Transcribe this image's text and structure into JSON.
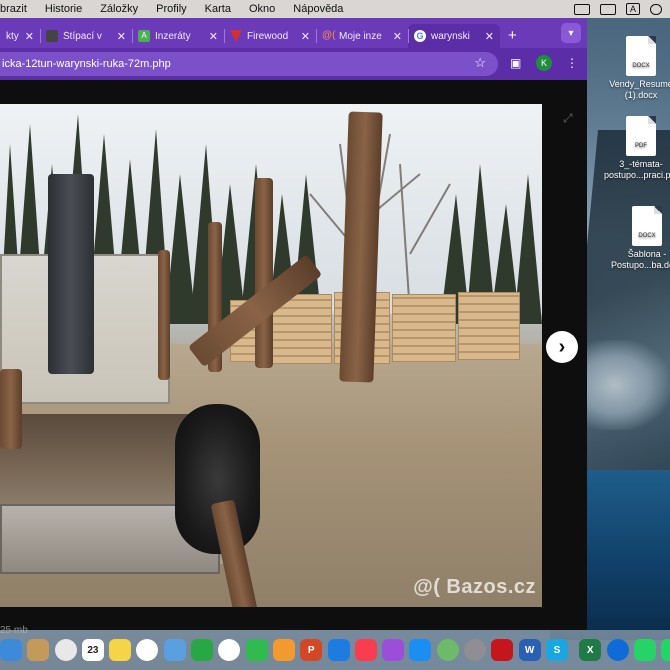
{
  "menubar": {
    "items": [
      "brazit",
      "Historie",
      "Záložky",
      "Profily",
      "Karta",
      "Okno",
      "Nápověda"
    ],
    "input_source": "A"
  },
  "browser": {
    "tabs": [
      {
        "title": "kty",
        "favicon_color": "#3a3a3a"
      },
      {
        "title": "Štípací v",
        "favicon_color": "#444444"
      },
      {
        "title": "Inzeráty",
        "favicon_color": "#4caf50"
      },
      {
        "title": "Firewood",
        "favicon_color": "#d32f2f"
      },
      {
        "title": "Moje inze",
        "favicon_color": "#e65100"
      },
      {
        "title": "warynski",
        "favicon_color": "#ffffff"
      }
    ],
    "new_tab": "+",
    "url": "icka-12tun-warynski-ruka-72m.php",
    "profile_initial": "K"
  },
  "photo": {
    "watermark": "@( Bazos.cz"
  },
  "page": {
    "bottom_text": "25 mb"
  },
  "desktop": {
    "files": [
      {
        "name": "Vendy_Resume (1).docx",
        "type": "DOCX"
      },
      {
        "name": "3_-témata-postupo...praci.pdf",
        "type": "PDF"
      },
      {
        "name": "Šablona - Postupo...ba.docx",
        "type": "DOCX"
      }
    ]
  },
  "dock": {
    "icons": [
      {
        "name": "finder-icon",
        "color": "#3d8bd8"
      },
      {
        "name": "wood-icon",
        "color": "#c49a5a"
      },
      {
        "name": "chrome-icon",
        "color": "#e8e8e8"
      },
      {
        "name": "calendar-icon",
        "color": "#ffffff",
        "label": "23"
      },
      {
        "name": "notes-icon",
        "color": "#f5d547"
      },
      {
        "name": "reminders-icon",
        "color": "#ffffff"
      },
      {
        "name": "maps-icon",
        "color": "#5aa0e0"
      },
      {
        "name": "numbers-icon",
        "color": "#27a844"
      },
      {
        "name": "photos-icon",
        "color": "#ffffff"
      },
      {
        "name": "facetime-icon",
        "color": "#2fbb4f"
      },
      {
        "name": "pages-icon",
        "color": "#f29a2e"
      },
      {
        "name": "powerpoint-icon",
        "color": "#d24726",
        "label": "P"
      },
      {
        "name": "keynote-icon",
        "color": "#1e7ce0"
      },
      {
        "name": "music-icon",
        "color": "#fa3c50"
      },
      {
        "name": "podcasts-icon",
        "color": "#9b4ed8"
      },
      {
        "name": "appstore-icon",
        "color": "#1b8ef2"
      },
      {
        "name": "maps-app-icon",
        "color": "#6dbb6a"
      },
      {
        "name": "settings-icon",
        "color": "#8e8e93"
      },
      {
        "name": "acrobat-icon",
        "color": "#c4161c"
      },
      {
        "name": "word-icon",
        "color": "#2b5fb4",
        "label": "W"
      },
      {
        "name": "skype-icon",
        "color": "#1aa6e0",
        "label": "S"
      },
      {
        "name": "excel-icon",
        "color": "#1f7a45",
        "label": "X"
      },
      {
        "name": "teamviewer-icon",
        "color": "#0e6bd8"
      },
      {
        "name": "whatsapp-icon",
        "color": "#25d366"
      },
      {
        "name": "whatsapp2-icon",
        "color": "#25d366"
      }
    ]
  }
}
